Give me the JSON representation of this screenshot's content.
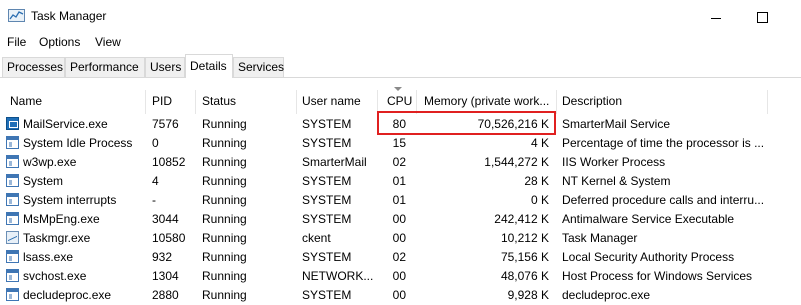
{
  "window": {
    "title": "Task Manager"
  },
  "menu": [
    "File",
    "Options",
    "View"
  ],
  "tabs": [
    {
      "label": "Processes",
      "active": false
    },
    {
      "label": "Performance",
      "active": false
    },
    {
      "label": "Users",
      "active": false
    },
    {
      "label": "Details",
      "active": true
    },
    {
      "label": "Services",
      "active": false
    }
  ],
  "columns": {
    "name": "Name",
    "pid": "PID",
    "status": "Status",
    "user": "User name",
    "cpu": "CPU",
    "memory": "Memory (private work...",
    "description": "Description"
  },
  "sorted_column": "cpu",
  "highlight_color": "#e02020",
  "rows": [
    {
      "icon": "mail-icon",
      "name": "MailService.exe",
      "pid": "7576",
      "status": "Running",
      "user": "SYSTEM",
      "cpu": "80",
      "memory": "70,526,216 K",
      "description": "SmarterMail Service"
    },
    {
      "icon": "process-icon",
      "name": "System Idle Process",
      "pid": "0",
      "status": "Running",
      "user": "SYSTEM",
      "cpu": "15",
      "memory": "4 K",
      "description": "Percentage of time the processor is ..."
    },
    {
      "icon": "process-icon",
      "name": "w3wp.exe",
      "pid": "10852",
      "status": "Running",
      "user": "SmarterMail",
      "cpu": "02",
      "memory": "1,544,272 K",
      "description": "IIS Worker Process"
    },
    {
      "icon": "process-icon",
      "name": "System",
      "pid": "4",
      "status": "Running",
      "user": "SYSTEM",
      "cpu": "01",
      "memory": "28 K",
      "description": "NT Kernel & System"
    },
    {
      "icon": "process-icon",
      "name": "System interrupts",
      "pid": "-",
      "status": "Running",
      "user": "SYSTEM",
      "cpu": "01",
      "memory": "0 K",
      "description": "Deferred procedure calls and interru..."
    },
    {
      "icon": "process-icon",
      "name": "MsMpEng.exe",
      "pid": "3044",
      "status": "Running",
      "user": "SYSTEM",
      "cpu": "00",
      "memory": "242,412 K",
      "description": "Antimalware Service Executable"
    },
    {
      "icon": "taskmgr-icon",
      "name": "Taskmgr.exe",
      "pid": "10580",
      "status": "Running",
      "user": "ckent",
      "cpu": "00",
      "memory": "10,212 K",
      "description": "Task Manager"
    },
    {
      "icon": "process-icon",
      "name": "lsass.exe",
      "pid": "932",
      "status": "Running",
      "user": "SYSTEM",
      "cpu": "02",
      "memory": "75,156 K",
      "description": "Local Security Authority Process"
    },
    {
      "icon": "process-icon",
      "name": "svchost.exe",
      "pid": "1304",
      "status": "Running",
      "user": "NETWORK...",
      "cpu": "00",
      "memory": "48,076 K",
      "description": "Host Process for Windows Services"
    },
    {
      "icon": "process-icon",
      "name": "decludeproc.exe",
      "pid": "2880",
      "status": "Running",
      "user": "SYSTEM",
      "cpu": "00",
      "memory": "9,928 K",
      "description": "decludeproc.exe"
    }
  ]
}
